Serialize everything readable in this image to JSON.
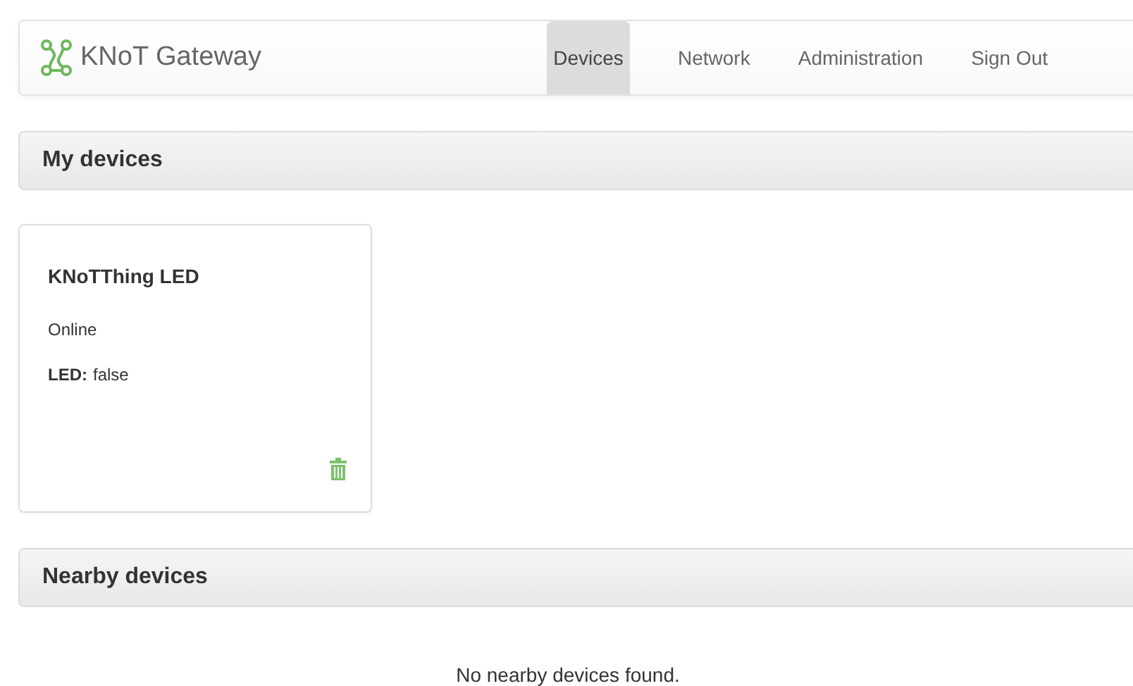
{
  "navbar": {
    "brand": "KNoT Gateway",
    "items": [
      {
        "label": "Devices",
        "selected": true
      },
      {
        "label": "Network",
        "selected": false
      },
      {
        "label": "Administration",
        "selected": false
      },
      {
        "label": "Sign Out",
        "selected": false
      }
    ]
  },
  "my_devices": {
    "title": "My devices",
    "devices": [
      {
        "name": "KNoTThing LED",
        "status": "Online",
        "properties": [
          {
            "name": "LED:",
            "value": "false"
          }
        ]
      }
    ]
  },
  "nearby_devices": {
    "title": "Nearby devices",
    "empty_message": "No nearby devices found."
  }
}
